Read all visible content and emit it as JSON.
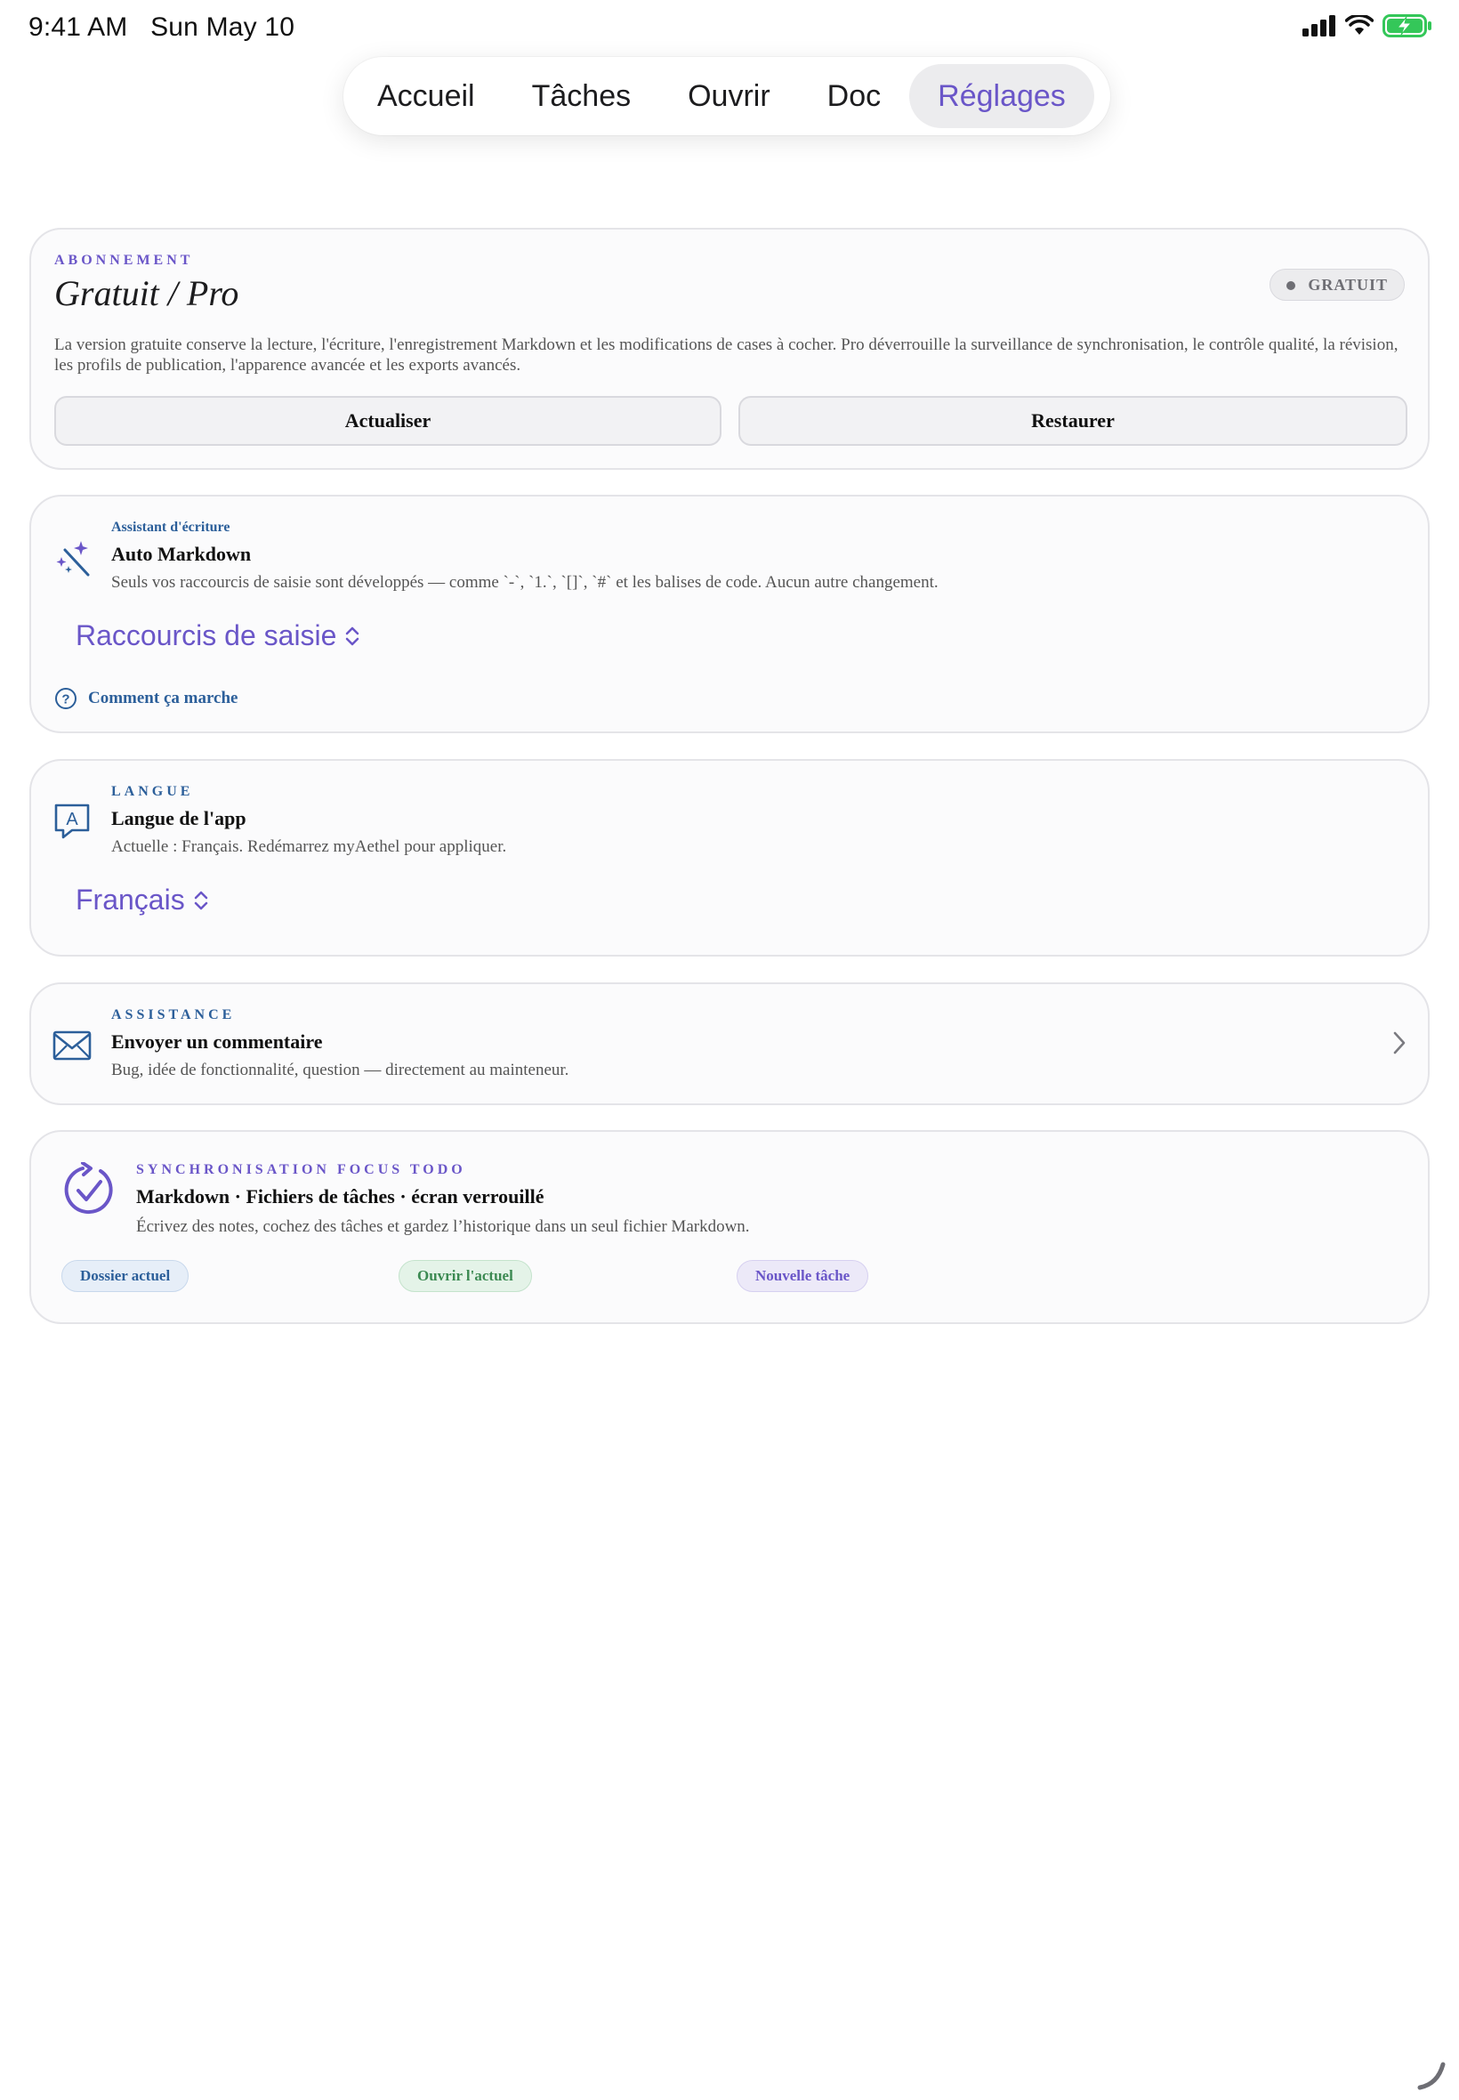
{
  "status_bar": {
    "time": "9:41 AM",
    "date": "Sun May 10"
  },
  "tabs": [
    {
      "label": "Accueil",
      "active": false
    },
    {
      "label": "Tâches",
      "active": false
    },
    {
      "label": "Ouvrir",
      "active": false
    },
    {
      "label": "Doc",
      "active": false
    },
    {
      "label": "Réglages",
      "active": true
    }
  ],
  "subscription": {
    "eyebrow": "ABONNEMENT",
    "title": "Gratuit / Pro",
    "badge": "GRATUIT",
    "description": "La version gratuite conserve la lecture, l'écriture, l'enregistrement Markdown et les modifications de cases à cocher. Pro déverrouille la surveillance de synchronisation, le contrôle qualité, la révision, les profils de publication, l'apparence avancée et les exports avancés.",
    "refresh_label": "Actualiser",
    "restore_label": "Restaurer"
  },
  "writing_assistant": {
    "eyebrow": "Assistant d'écriture",
    "title": "Auto Markdown",
    "description": "Seuls vos raccourcis de saisie sont développés — comme `-`, `1.`, `[]`, `#` et les balises de code. Aucun autre changement.",
    "picker_value": "Raccourcis de saisie",
    "help_link": "Comment ça marche",
    "icon": "magic-wand-icon"
  },
  "language": {
    "eyebrow": "LANGUE",
    "title": "Langue de l'app",
    "description": "Actuelle : Français. Redémarrez myAethel pour appliquer.",
    "picker_value": "Français",
    "icon": "language-bubble-icon"
  },
  "support": {
    "eyebrow": "ASSISTANCE",
    "title": "Envoyer un commentaire",
    "description": "Bug, idée de fonctionnalité, question — directement au mainteneur.",
    "icon": "envelope-icon"
  },
  "focus_sync": {
    "eyebrow": "SYNCHRONISATION FOCUS TODO",
    "title": "Markdown · Fichiers de tâches · écran verrouillé",
    "description": "Écrivez des notes, cochez des tâches et gardez l’historique dans un seul fichier Markdown.",
    "chips": [
      "Dossier actuel",
      "Ouvrir l'actuel",
      "Nouvelle tâche"
    ],
    "icon": "sync-check-icon"
  },
  "colors": {
    "accent": "#6a56c8",
    "link_blue": "#2c5f9a",
    "battery_green": "#34c759"
  }
}
